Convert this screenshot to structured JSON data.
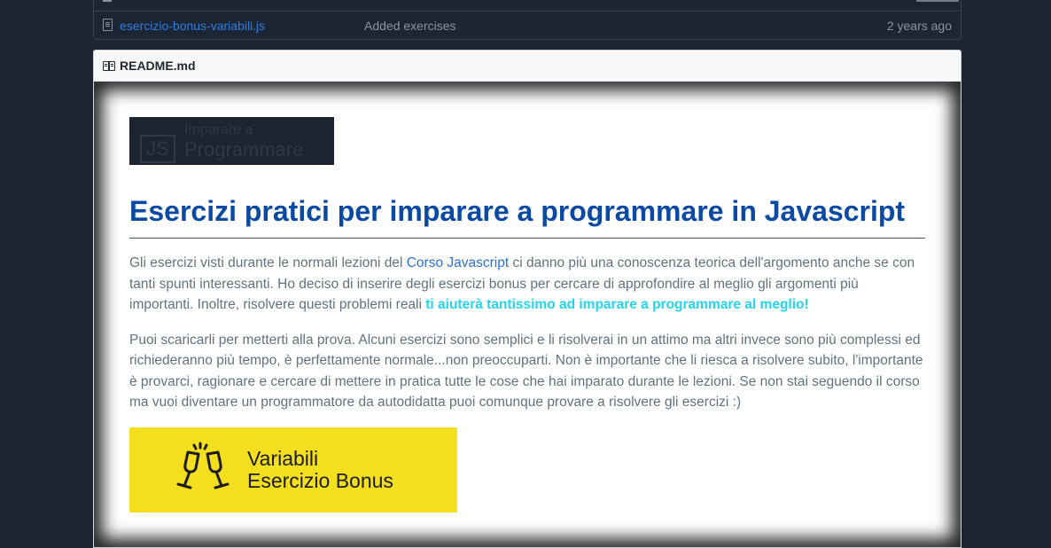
{
  "file_list": {
    "row": {
      "name": "esercizio-bonus-variabili.js",
      "message": "Added exercises",
      "age": "2 years ago"
    }
  },
  "readme": {
    "filename": "README.md",
    "logo": {
      "line1": "Imparare a",
      "line2": "Programmare",
      "badge": "JS"
    },
    "heading": "Esercizi pratici per imparare a programmare in Javascript",
    "p1_before": "Gli esercizi visti durante le normali lezioni del ",
    "p1_link": "Corso Javascript",
    "p1_after": " ci danno più una conoscenza teorica dell'argomento anche se con tanti spunti interessanti. Ho deciso di inserire degli esercizi bonus per cercare di approfondire al meglio gli argomenti più importanti. Inoltre, risolvere questi problemi reali ",
    "p1_highlight": "ti aiuterà tantissimo ad imparare a programmare al meglio!",
    "p2": "Puoi scaricarli per metterti alla prova. Alcuni esercizi sono semplici e li risolverai in un attimo ma altri invece sono più complessi ed richiederanno più tempo, è perfettamente normale...non preoccuparti. Non è importante che li riesca a risolvere subito, l'importante è provarci, ragionare e cercare di mettere in pratica tutte le cose che hai imparato durante le lezioni. Se non stai seguendo il corso ma vuoi diventare un programmatore da autodidatta puoi comunque provare a risolvere gli esercizi :)",
    "banner": {
      "line1": "Variabili",
      "line2": "Esercizio Bonus",
      "icon": "champagne-glasses-icon"
    }
  },
  "colors": {
    "page_bg": "#1b2533",
    "link": "#2f7de1",
    "heading": "#0a4aa3",
    "highlight": "#23d4ec",
    "banner_bg": "#f4df1f"
  }
}
